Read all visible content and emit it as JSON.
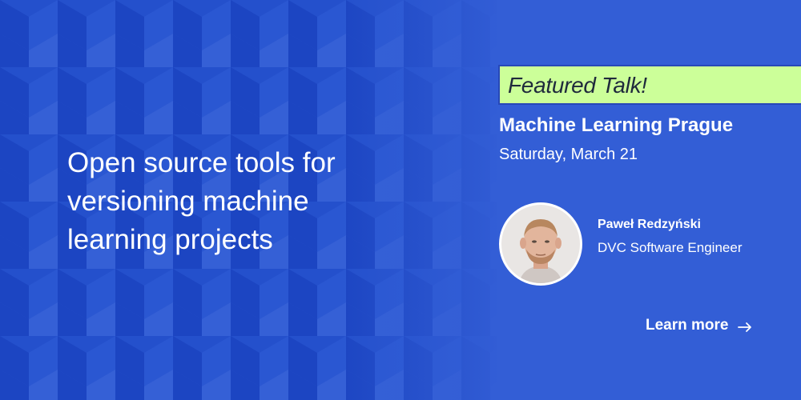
{
  "headline": "Open source tools for versioning machine learning projects",
  "badge": {
    "label": "Featured Talk!"
  },
  "event": {
    "name": "Machine Learning Prague",
    "date": "Saturday, March 21"
  },
  "speaker": {
    "name": "Paweł Redzyński",
    "role": "DVC Software Engineer"
  },
  "cta": {
    "label": "Learn more",
    "icon": "arrow-right-icon"
  },
  "colors": {
    "background": "#335ed6",
    "pattern_dark": "#1f46c4",
    "pattern_light": "#3a64d9",
    "badge": "#ccff99",
    "text": "#ffffff"
  }
}
